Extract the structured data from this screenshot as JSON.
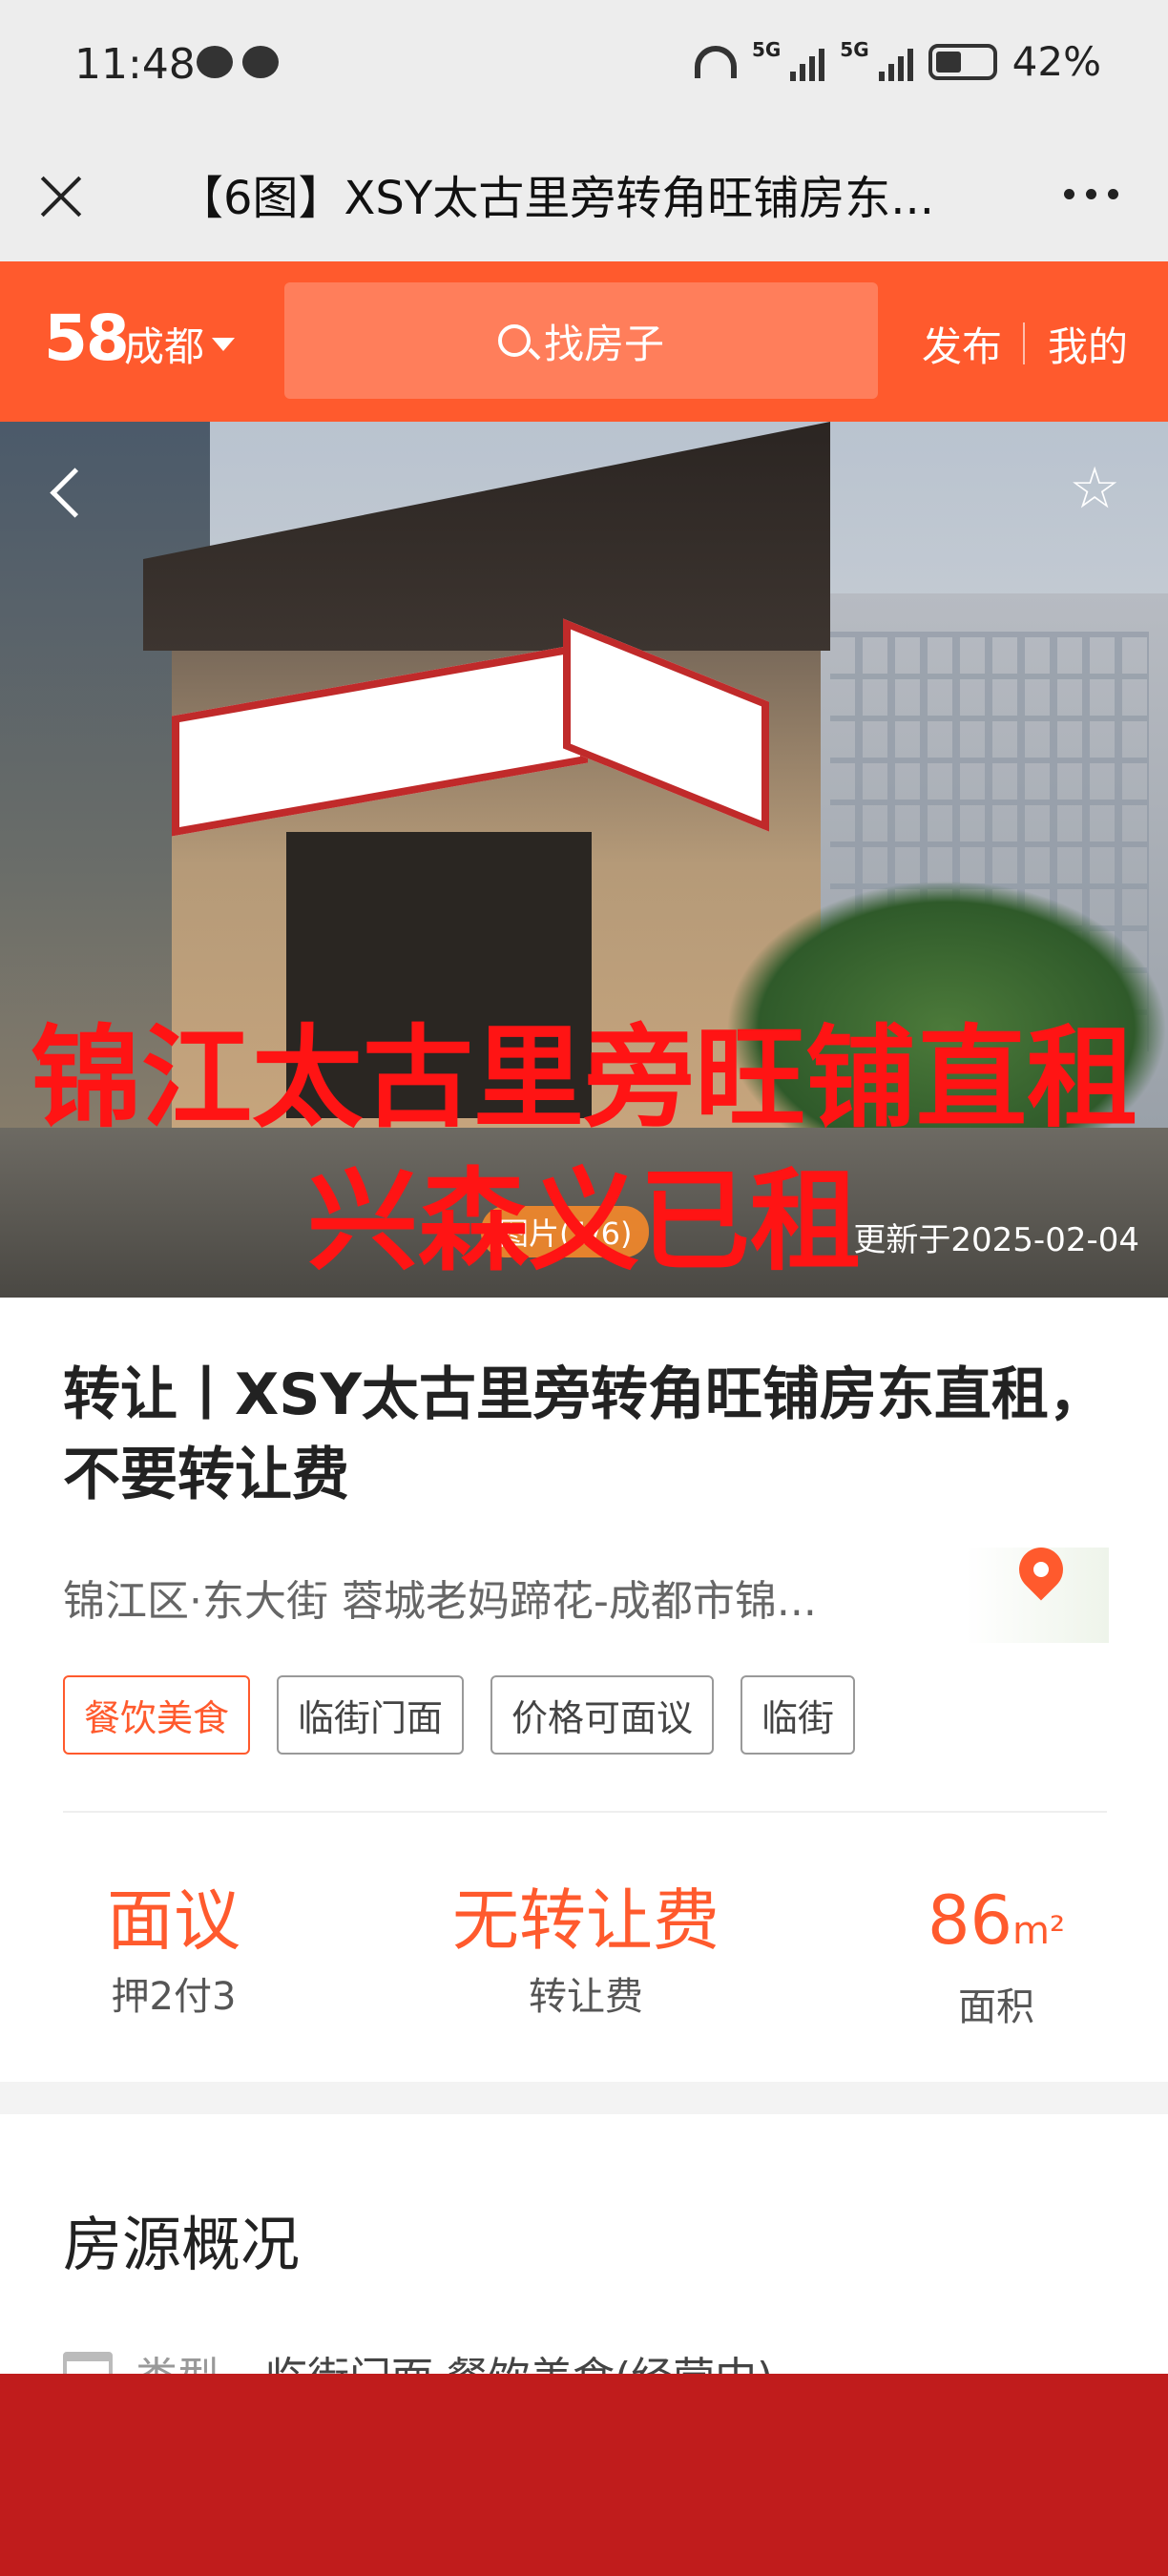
{
  "status_bar": {
    "time": "11:48",
    "network_1": "5G",
    "network_2": "5G",
    "battery": "42%"
  },
  "title_bar": {
    "title": "【6图】XSY太古里旁转角旺铺房东..."
  },
  "app_header": {
    "logo": "58",
    "city": "成都",
    "search_placeholder": "找房子",
    "publish": "发布",
    "mine": "我的"
  },
  "hero": {
    "overlay_line1": "锦江太古里旁旺铺直租",
    "overlay_line2": "兴森义已租",
    "counter": "图片(1/6)",
    "updated": "更新于2025-02-04"
  },
  "listing": {
    "title": "转让丨XSY太古里旁转角旺铺房东直租，不要转让费",
    "address": "锦江区·东大街 蓉城老妈蹄花-成都市锦...",
    "tags": [
      "餐饮美食",
      "临街门面",
      "价格可面议",
      "临街"
    ],
    "stats": [
      {
        "value": "面议",
        "unit": "",
        "label": "押2付3"
      },
      {
        "value": "无转让费",
        "unit": "",
        "label": "转让费"
      },
      {
        "value": "86",
        "unit": "m²",
        "label": "面积"
      }
    ]
  },
  "overview": {
    "heading": "房源概况",
    "type_label": "类型",
    "type_value": "临街门面·餐饮美食(经营中)"
  },
  "colors": {
    "brand": "#ff5a2d",
    "overlay_text": "#ff1414",
    "bottom_bar": "#c01c1c"
  }
}
